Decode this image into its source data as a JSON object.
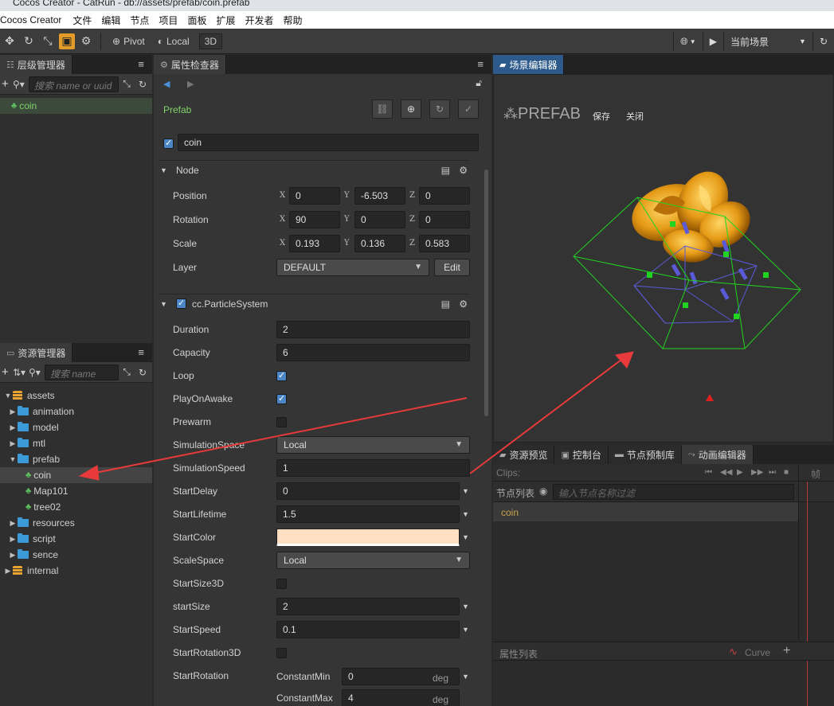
{
  "window": {
    "title": "Cocos Creator - CatRun - db://assets/prefab/coin.prefab"
  },
  "menu": {
    "app": "Cocos Creator",
    "items": [
      "文件",
      "编辑",
      "节点",
      "项目",
      "面板",
      "扩展",
      "开发者",
      "帮助"
    ]
  },
  "toolbar": {
    "pivot_label": "Pivot",
    "local_label": "Local",
    "mode_3d_label": "3D",
    "scene_select_value": "当前场景"
  },
  "hierarchy": {
    "tab_label": "层级管理器",
    "search_placeholder": "搜索 name or uuid",
    "items": [
      {
        "label": "coin"
      }
    ]
  },
  "assets": {
    "tab_label": "资源管理器",
    "search_placeholder": "搜索 name",
    "tree": [
      {
        "label": "assets"
      },
      {
        "label": "animation"
      },
      {
        "label": "model"
      },
      {
        "label": "mtl"
      },
      {
        "label": "prefab"
      },
      {
        "label": "coin"
      },
      {
        "label": "Map101"
      },
      {
        "label": "tree02"
      },
      {
        "label": "resources"
      },
      {
        "label": "script"
      },
      {
        "label": "sence"
      },
      {
        "label": "internal"
      }
    ]
  },
  "inspector": {
    "tab_label": "属性检查器",
    "type_label": "Prefab",
    "node_name": "coin",
    "node_section": {
      "title": "Node",
      "position": {
        "label": "Position",
        "x": "0",
        "y": "-6.503",
        "z": "0"
      },
      "rotation": {
        "label": "Rotation",
        "x": "90",
        "y": "0",
        "z": "0"
      },
      "scale": {
        "label": "Scale",
        "x": "0.193",
        "y": "0.136",
        "z": "0.583"
      },
      "layer": {
        "label": "Layer",
        "value": "DEFAULT",
        "edit_label": "Edit"
      },
      "axis_x": "X",
      "axis_y": "Y",
      "axis_z": "Z"
    },
    "particle_section": {
      "title": "cc.ParticleSystem",
      "duration": {
        "label": "Duration",
        "value": "2"
      },
      "capacity": {
        "label": "Capacity",
        "value": "6"
      },
      "loop": {
        "label": "Loop",
        "checked": true
      },
      "play_on_awake": {
        "label": "PlayOnAwake",
        "checked": true
      },
      "prewarm": {
        "label": "Prewarm",
        "checked": false
      },
      "simulation_space": {
        "label": "SimulationSpace",
        "value": "Local"
      },
      "simulation_speed": {
        "label": "SimulationSpeed",
        "value": "1"
      },
      "start_delay": {
        "label": "StartDelay",
        "value": "0"
      },
      "start_lifetime": {
        "label": "StartLifetime",
        "value": "1.5"
      },
      "start_color": {
        "label": "StartColor",
        "color": "#ffe0c2"
      },
      "scale_space": {
        "label": "ScaleSpace",
        "value": "Local"
      },
      "start_size_3d": {
        "label": "StartSize3D",
        "checked": false
      },
      "start_size": {
        "label": "startSize",
        "value": "2"
      },
      "start_speed": {
        "label": "StartSpeed",
        "value": "0.1"
      },
      "start_rotation_3d": {
        "label": "StartRotation3D",
        "checked": false
      },
      "start_rotation": {
        "label": "StartRotation",
        "min_label": "ConstantMin",
        "min_value": "0",
        "max_label": "ConstantMax",
        "max_value": "4",
        "unit": "deg"
      }
    }
  },
  "scene": {
    "tab_label": "场景编辑器",
    "prefab_title": "PREFAB",
    "save_label": "保存",
    "close_label": "关闭",
    "gizmo_color": "#21d421",
    "bbox_color": "#5a5ad8"
  },
  "bottom": {
    "tabs": [
      "资源预览",
      "控制台",
      "节点预制库",
      "动画编辑器"
    ],
    "clips_label": "Clips:",
    "node_list_label": "节点列表",
    "node_filter_placeholder": "输入节点名称过滤",
    "node_item": "coin",
    "frame_label": "帧",
    "props_label": "属性列表",
    "curve_label": "Curve"
  },
  "colors": {
    "accent": "#e39b2a",
    "selection_blue": "#2c5a8a",
    "node_green": "#7fd36a",
    "folder_blue": "#3d9ad9",
    "arrow_red": "#e83a3a"
  }
}
